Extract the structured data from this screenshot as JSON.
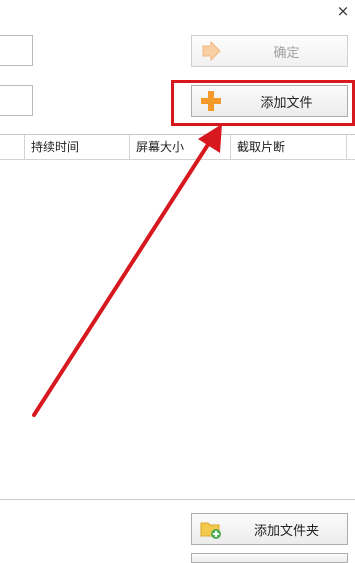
{
  "window": {
    "close_glyph": "×"
  },
  "buttons": {
    "confirm_label": "确定",
    "add_file_label": "添加文件",
    "add_folder_label": "添加文件夹"
  },
  "table": {
    "columns": [
      "持续时间",
      "屏幕大小",
      "截取片断"
    ]
  },
  "icons": {
    "confirm": "arrow-right-icon",
    "add_file": "plus-icon",
    "add_folder": "folder-add-icon"
  },
  "colors": {
    "annotation_red": "#d7191f",
    "plus_orange": "#f39a2b",
    "folder_yellow": "#f2c94c",
    "add_green": "#4caf50"
  }
}
